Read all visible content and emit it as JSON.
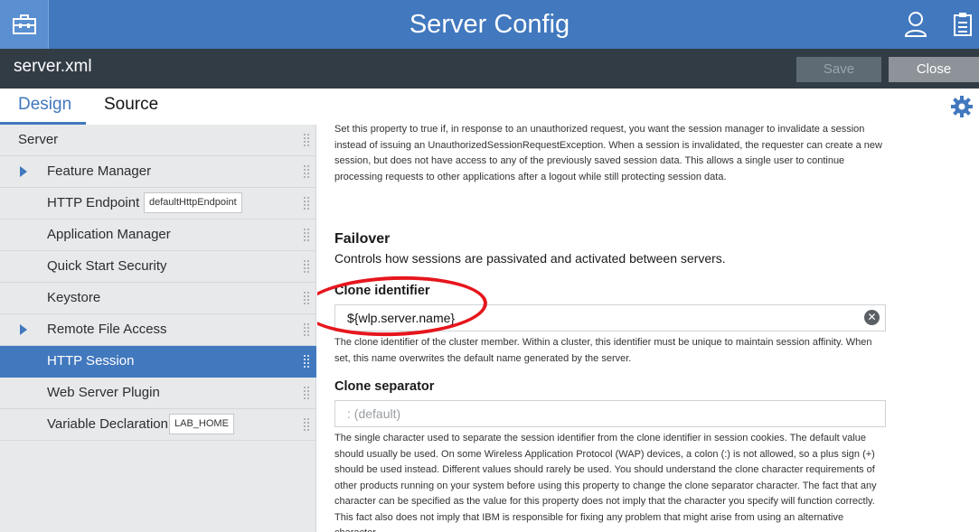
{
  "app": {
    "title": "Server Config"
  },
  "toolbar": {
    "toolbox_icon": "toolbox-icon",
    "user_icon": "user-icon",
    "clipboard_icon": "clipboard-icon"
  },
  "file": {
    "name": "server.xml",
    "save_label": "Save",
    "close_label": "Close"
  },
  "tabs": [
    {
      "label": "Design",
      "active": true
    },
    {
      "label": "Source",
      "active": false
    }
  ],
  "gear_icon": "gear-icon",
  "sidebar": {
    "items": [
      {
        "label": "Server",
        "level": 0,
        "expandable": false,
        "chip": ""
      },
      {
        "label": "Feature Manager",
        "level": 1,
        "expandable": true,
        "chip": ""
      },
      {
        "label": "HTTP Endpoint",
        "level": 1,
        "expandable": false,
        "chip": "defaultHttpEndpoint"
      },
      {
        "label": "Application Manager",
        "level": 1,
        "expandable": false,
        "chip": ""
      },
      {
        "label": "Quick Start Security",
        "level": 1,
        "expandable": false,
        "chip": ""
      },
      {
        "label": "Keystore",
        "level": 1,
        "expandable": false,
        "chip": ""
      },
      {
        "label": "Remote File Access",
        "level": 1,
        "expandable": true,
        "chip": ""
      },
      {
        "label": "HTTP Session",
        "level": 1,
        "expandable": false,
        "chip": "",
        "selected": true
      },
      {
        "label": "Web Server Plugin",
        "level": 1,
        "expandable": false,
        "chip": ""
      },
      {
        "label": "Variable Declaration",
        "level": 1,
        "expandable": false,
        "chip": "LAB_HOME"
      }
    ]
  },
  "content": {
    "top_description": "Set this property to true if, in response to an unauthorized request, you want the session manager to invalidate a session instead of issuing an UnauthorizedSessionRequestException. When a session is invalidated, the requester can create a new session, but does not have access to any of the previously saved session data. This allows a single user to continue processing requests to other applications after a logout while still protecting session data.",
    "failover": {
      "title": "Failover",
      "subtitle": "Controls how sessions are passivated and activated between servers."
    },
    "clone_identifier": {
      "label": "Clone identifier",
      "value": "${wlp.server.name}",
      "help": "The clone identifier of the cluster member. Within a cluster, this identifier must be unique to maintain session affinity. When set, this name overwrites the default name generated by the server."
    },
    "clone_separator": {
      "label": "Clone separator",
      "placeholder": ": (default)",
      "value": "",
      "help": "The single character used to separate the session identifier from the clone identifier in session cookies. The default value should usually be used. On some Wireless Application Protocol (WAP) devices, a colon (:) is not allowed, so a plus sign (+) should be used instead. Different values should rarely be used. You should understand the clone character requirements of other products running on your system before using this property to change the clone separator character. The fact that any character can be specified as the value for this property does not imply that the character you specify will function correctly. This fact also does not imply that IBM is responsible for fixing any problem that might arise from using an alternative character."
    }
  },
  "colors": {
    "primary": "#4178be",
    "filebar": "#323c45",
    "annotation": "#e6161d"
  }
}
